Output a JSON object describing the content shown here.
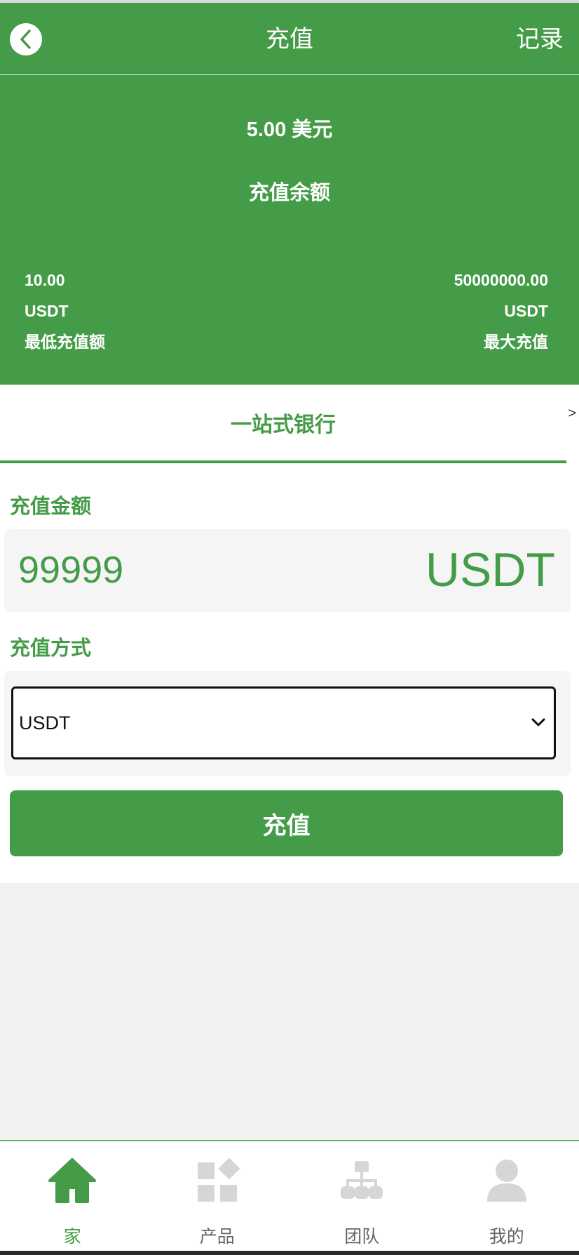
{
  "header": {
    "title": "充值",
    "records_label": "记录"
  },
  "balance": {
    "amount": "5.00 美元",
    "label": "充值余额",
    "min": {
      "value": "10.00",
      "unit": "USDT",
      "label": "最低充值额"
    },
    "max": {
      "value": "50000000.00",
      "unit": "USDT",
      "label": "最大充值"
    }
  },
  "tabs": {
    "active_label": "一站式银行",
    "more_label": ">"
  },
  "form": {
    "amount_label": "充值金额",
    "amount_value": "99999",
    "amount_unit": "USDT",
    "method_label": "充值方式",
    "method_selected": "USDT",
    "submit_label": "充值"
  },
  "nav": {
    "items": [
      {
        "label": "家",
        "icon": "home-icon",
        "active": true
      },
      {
        "label": "产品",
        "icon": "grid-icon",
        "active": false
      },
      {
        "label": "团队",
        "icon": "org-chart-icon",
        "active": false
      },
      {
        "label": "我的",
        "icon": "user-icon",
        "active": false
      }
    ]
  },
  "colors": {
    "brand_green": "#459c48",
    "inactive_icon": "#d6d6d6",
    "page_bg": "#f1f1f1"
  }
}
